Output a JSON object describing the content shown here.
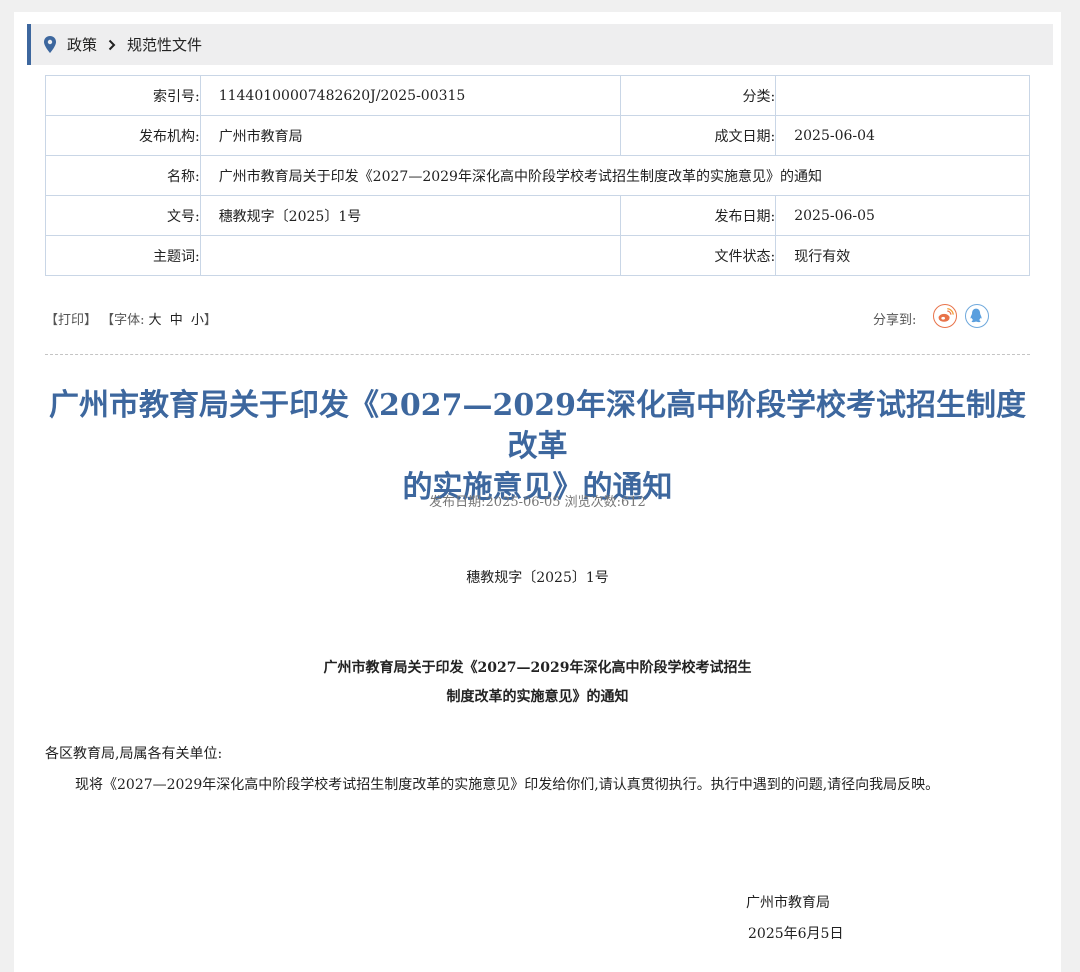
{
  "breadcrumb": {
    "first": "政策",
    "second": "规范性文件"
  },
  "meta": {
    "index_label": "索引号:",
    "index_value": "11440100007482620J/2025-00315",
    "category_label": "分类:",
    "category_value": "",
    "org_label": "发布机构:",
    "org_value": "广州市教育局",
    "written_label": "成文日期:",
    "written_value": "2025-06-04",
    "name_label": "名称:",
    "name_value": "广州市教育局关于印发《2027—2029年深化高中阶段学校考试招生制度改革的实施意见》的通知",
    "docno_label": "文号:",
    "docno_value": "穗教规字〔2025〕1号",
    "pubdate_label": "发布日期:",
    "pubdate_value": "2025-06-05",
    "keywords_label": "主题词:",
    "keywords_value": "",
    "status_label": "文件状态:",
    "status_value": "现行有效"
  },
  "tools": {
    "print": "【打印】",
    "font_prefix": "【字体:",
    "size_large": "大",
    "size_medium": "中",
    "size_small": "小",
    "font_suffix": "】",
    "share_label": "分享到:"
  },
  "icons": {
    "location": "location-pin-icon",
    "weibo": "weibo-icon",
    "qq": "qq-icon",
    "chevron": "chevron-right-icon"
  },
  "colors": {
    "accent": "#3d679e",
    "weibo": "#e8734a",
    "qq": "#6ea8dc"
  },
  "article": {
    "title_line1": "广州市教育局关于印发《2027—2029年深化高中阶段学校考试招生制度改革",
    "title_line2": "的实施意见》的通知",
    "pub_line": "发布日期:2025-06-05 浏览次数:612",
    "doc_no": "穗教规字〔2025〕1号",
    "subtitle_line1": "广州市教育局关于印发《2027—2029年深化高中阶段学校考试招生",
    "subtitle_line2": "制度改革的实施意见》的通知",
    "salutation": "各区教育局,局属各有关单位:",
    "body": "现将《2027—2029年深化高中阶段学校考试招生制度改革的实施意见》印发给你们,请认真贯彻执行。执行中遇到的问题,请径向我局反映。",
    "sign_org": "广州市教育局",
    "sign_date": "2025年6月5日"
  }
}
